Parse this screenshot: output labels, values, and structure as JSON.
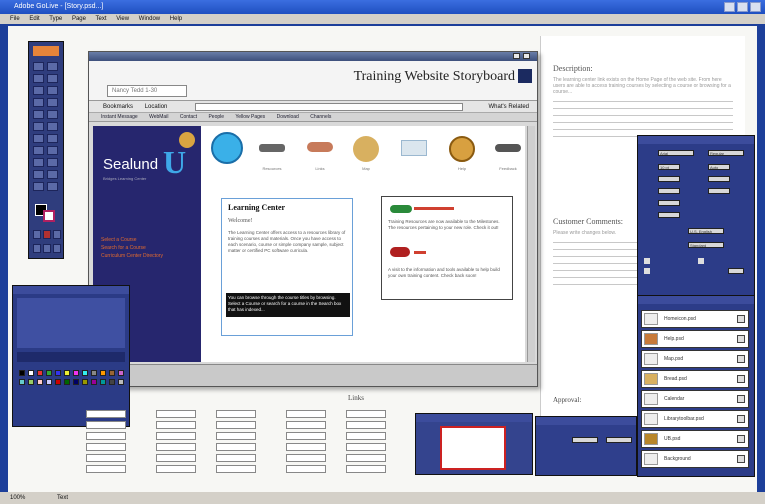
{
  "window": {
    "title": "Adobe GoLive - [Story.psd...]"
  },
  "menu": [
    "File",
    "Edit",
    "Type",
    "Page",
    "Text",
    "View",
    "Window",
    "Help"
  ],
  "storyboard": {
    "heading": "Training Website Storyboard",
    "field_value": "Nancy Tedd 1-30"
  },
  "browser": {
    "back_label": "Bookmarks",
    "location_label": "Location",
    "related_label": "What's Related",
    "links": [
      "Instant Message",
      "WebMail",
      "Contact",
      "People",
      "Yellow Pages",
      "Download",
      "Channels"
    ]
  },
  "site": {
    "logo_text": "Sealund",
    "logo_letter": "U",
    "logo_sub": "Bridges Learning Center",
    "nav_links": [
      "Select a Course",
      "Search for a Course",
      "Curriculum Center Directory"
    ],
    "icons": [
      {
        "name": "globe-icon",
        "caption": "",
        "color": "#3ab0e8"
      },
      {
        "name": "shoes-icon",
        "caption": "Resources",
        "color": "#666666"
      },
      {
        "name": "hands-icon",
        "caption": "Links",
        "color": "#c77a5a"
      },
      {
        "name": "bread-icon",
        "caption": "Map",
        "color": "#d8b060"
      },
      {
        "name": "calendar-icon",
        "caption": "",
        "color": "#9bb8d0"
      },
      {
        "name": "clock-icon",
        "caption": "Help",
        "color": "#d8a040"
      },
      {
        "name": "glasses-icon",
        "caption": "Feedback",
        "color": "#555555"
      }
    ],
    "learning": {
      "title": "Learning Center",
      "welcome": "Welcome!",
      "body": "The Learning Center offers access to a resources library of training courses and materials. Once you have access to each scenario, course or simple company sample, subject matter or certified PC software curricula.",
      "highlight": "You can browse through the course titles by browsing. Select a Course or search for a course in the Search box that has indexed..."
    },
    "side": {
      "p1": "Training Resources are now available to the Milestones. The resources pertaining to your new role. Check it out!",
      "p2": "A visit to the information and tools available to help build your own training content. Check back soon!"
    }
  },
  "doc": {
    "description_heading": "Description:",
    "description_text": "The learning center link exists on the Home Page of the web site. From here users are able to access training courses by selecting a course or browsing for a course...",
    "comments_heading": "Customer Comments:",
    "comments_text": "Please write changes below.",
    "approval_label": "Approval:",
    "links_heading": "Links"
  },
  "library": {
    "items": [
      "Homeicon.psd",
      "Help.psd",
      "Map.psd",
      "Bread.psd",
      "Calendar",
      "Librarytoolbar.psd",
      "UB.psd",
      "Background"
    ]
  },
  "character": {
    "font": "Arial",
    "style": "Regular",
    "size": "10 pt",
    "leading": "Auto",
    "lang": "U.S. English",
    "aa": "Standard"
  },
  "status": {
    "zoom": "100%",
    "mode": "Text"
  },
  "colors": {
    "navy": "#26266e",
    "panel": "#2c3c88",
    "accent_orange": "#e36a2e",
    "accent_blue": "#3ea8e8"
  }
}
